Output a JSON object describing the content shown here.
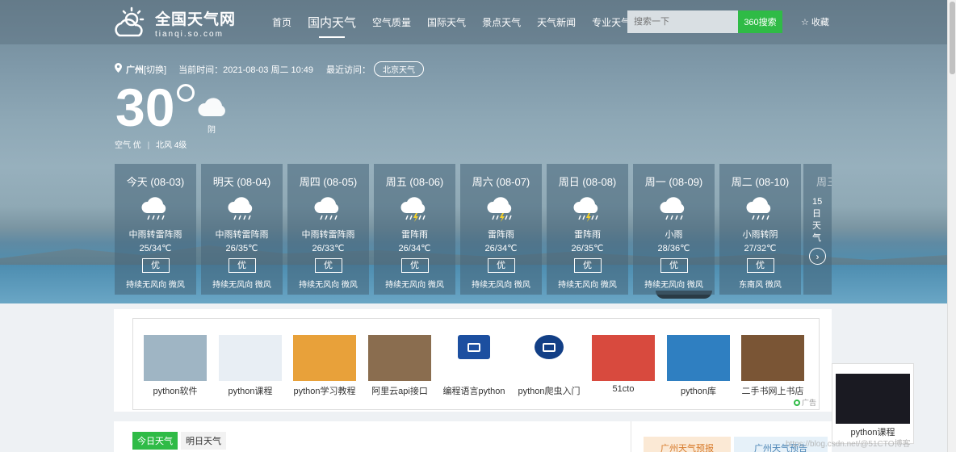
{
  "header": {
    "logo_cn": "全国天气网",
    "logo_en": "tianqi.so.com",
    "nav": [
      "首页",
      "国内天气",
      "空气质量",
      "国际天气",
      "景点天气",
      "天气新闻",
      "专业天气"
    ],
    "search_placeholder": "搜索一下",
    "search_button": "360搜索",
    "favorite": "收藏"
  },
  "location": {
    "city": "广州",
    "switch": "[切换]",
    "time": "当前时间：2021-08-03  周二  10:49",
    "recent_label": "最近访问：",
    "recent_city": "北京天气"
  },
  "current": {
    "temp": "30",
    "desc": "阴",
    "air": "空气 优",
    "wind": "北风 4级"
  },
  "forecast": [
    {
      "day": "今天 (08-03)",
      "weather": "中雨转雷阵雨",
      "temp": "25/34℃",
      "aqi": "优",
      "wind": "持续无风向 微风",
      "icon": "rain-cloud-icon"
    },
    {
      "day": "明天 (08-04)",
      "weather": "中雨转雷阵雨",
      "temp": "26/35℃",
      "aqi": "优",
      "wind": "持续无风向 微风",
      "icon": "rain-cloud-icon"
    },
    {
      "day": "周四 (08-05)",
      "weather": "中雨转雷阵雨",
      "temp": "26/33℃",
      "aqi": "优",
      "wind": "持续无风向 微风",
      "icon": "rain-cloud-icon"
    },
    {
      "day": "周五 (08-06)",
      "weather": "雷阵雨",
      "temp": "26/34℃",
      "aqi": "优",
      "wind": "持续无风向 微风",
      "icon": "thunder-cloud-icon"
    },
    {
      "day": "周六 (08-07)",
      "weather": "雷阵雨",
      "temp": "26/34℃",
      "aqi": "优",
      "wind": "持续无风向 微风",
      "icon": "thunder-cloud-icon"
    },
    {
      "day": "周日 (08-08)",
      "weather": "雷阵雨",
      "temp": "26/35℃",
      "aqi": "优",
      "wind": "持续无风向 微风",
      "icon": "thunder-cloud-icon"
    },
    {
      "day": "周一 (08-09)",
      "weather": "小雨",
      "temp": "28/36℃",
      "aqi": "优",
      "wind": "持续无风向 微风",
      "icon": "rain-cloud-icon"
    },
    {
      "day": "周二 (08-10)",
      "weather": "小雨转阴",
      "temp": "27/32℃",
      "aqi": "优",
      "wind": "东南风 微风",
      "icon": "rain-cloud-icon"
    }
  ],
  "more_days": {
    "label": "周三",
    "text": "15日天气"
  },
  "ads": [
    {
      "label": "python软件",
      "color": "#9fb5c4"
    },
    {
      "label": "python课程",
      "color": "#e8eef4"
    },
    {
      "label": "python学习教程",
      "color": "#e8a13a"
    },
    {
      "label": "阿里云api接口",
      "color": "#8a6d4f"
    },
    {
      "label": "编程语言python",
      "color": "#1c4fa0"
    },
    {
      "label": "python爬虫入门",
      "color": "#123f86"
    },
    {
      "label": "51cto",
      "color": "#d84a3e"
    },
    {
      "label": "python库",
      "color": "#2f7fc1"
    },
    {
      "label": "二手书网上书店",
      "color": "#7a5535"
    }
  ],
  "ad_tag": "广告",
  "side_ad": {
    "label": "python课程"
  },
  "bottom": {
    "tab_today": "今日天气",
    "tab_tomorrow": "明日天气",
    "forecast1": "广州天气预报",
    "forecast2": "广州天气预告",
    "watermark": "https://blog.csdn.net/@51CTO博客"
  }
}
